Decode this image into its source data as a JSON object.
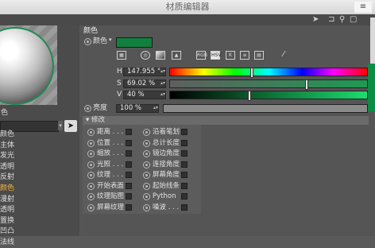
{
  "window": {
    "title": "材质编辑器",
    "menu_label": "≡"
  },
  "toolbar": {
    "icons": [
      "cursor-arrow",
      "lock",
      "pin",
      "window"
    ]
  },
  "left_panel": {
    "label_top": "色",
    "channels": [
      {
        "label": "颜色",
        "selected": false
      },
      {
        "label": "主体",
        "selected": false
      },
      {
        "label": "发光",
        "selected": false
      },
      {
        "label": "透明",
        "selected": false
      },
      {
        "label": "反射",
        "selected": false
      },
      {
        "label": "颜色",
        "selected": true
      },
      {
        "label": "漫射",
        "selected": false
      },
      {
        "label": "透明",
        "selected": false
      },
      {
        "label": "置换",
        "selected": false
      },
      {
        "label": "凹凸",
        "selected": false
      },
      {
        "label": "法线",
        "selected": false
      }
    ]
  },
  "color_section": {
    "header": "颜色",
    "color_label": "颜色",
    "color_swatch": "#11803f",
    "modes": [
      "RGB",
      "HSV",
      "K",
      "IMG",
      "MIX",
      "TEMP",
      "SPEC",
      "PICK"
    ],
    "active_mode": "HSV",
    "h": {
      "label": "H",
      "value": "147.955 °",
      "fraction": 0.41
    },
    "s": {
      "label": "S",
      "value": "69.02 %",
      "fraction": 0.69
    },
    "v": {
      "label": "V",
      "value": "40 %",
      "fraction": 0.4
    },
    "brightness": {
      "label": "亮度",
      "value": "100 %",
      "fraction": 1.0
    }
  },
  "modifier_section": {
    "title": "▾ 修改",
    "left_items": [
      "距离 . . .",
      "位置 . . .",
      "缩放 . . .",
      "光照 . . .",
      "纹理 . . .",
      "开始表面",
      "纹理贴图",
      "屏幕纹理"
    ],
    "right_items": [
      "沿着笔划",
      "总计长度",
      "镜边角度",
      "连接角度",
      "屏幕角度",
      "起始线条",
      "Python",
      "噪波 . . ."
    ]
  }
}
